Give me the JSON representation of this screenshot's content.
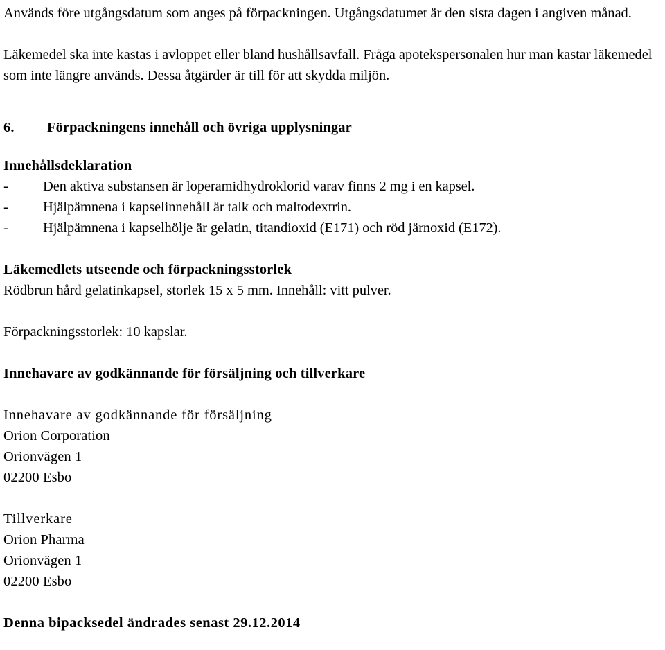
{
  "document": {
    "language": "sv",
    "background_color": "#ffffff",
    "text_color": "#000000"
  },
  "intro": {
    "paragraph_1": "Används före utgångsdatum som anges på förpackningen. Utgångsdatumet är den sista dagen i angiven månad.",
    "paragraph_2": "Läkemedel ska inte kastas i avloppet eller bland hushållsavfall. Fråga apotekspersonalen hur man kastar läkemedel som inte längre används. Dessa åtgärder är till för att skydda miljön."
  },
  "section": {
    "number": "6.",
    "title": "Förpackningens innehåll och övriga upplysningar"
  },
  "ingredients": {
    "heading": "Innehållsdeklaration",
    "bullet_marker": "-",
    "items": [
      "Den aktiva substansen är loperamidhydroklorid varav finns 2 mg i en kapsel.",
      "Hjälpämnena i kapselinnehåll är talk och maltodextrin.",
      "Hjälpämnena i kapselhölje är gelatin, titandioxid (E171) och röd järnoxid (E172)."
    ]
  },
  "appearance": {
    "heading": "Läkemedlets utseende och förpackningsstorlek",
    "description": "Rödbrun hård gelatinkapsel, storlek 15 x 5 mm. Innehåll: vitt pulver.",
    "pack_size": "Förpackningsstorlek: 10 kapslar."
  },
  "marketing": {
    "heading": "Innehavare av godkännande för försäljning och tillverkare",
    "holder": {
      "label": "Innehavare av godkännande för försäljning",
      "address": [
        "Orion Corporation",
        "Orionvägen 1",
        "02200 Esbo"
      ]
    },
    "manufacturer": {
      "label": "Tillverkare",
      "address": [
        "Orion Pharma",
        "Orionvägen 1",
        "02200 Esbo"
      ]
    }
  },
  "footer": {
    "revision_line": "Denna bipacksedel ändrades senast 29.12.2014"
  }
}
